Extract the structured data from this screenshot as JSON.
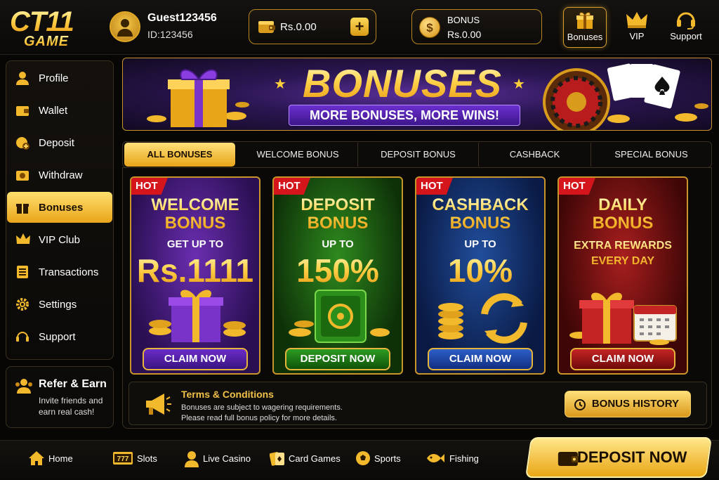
{
  "brand": {
    "logo_line1": "CT11",
    "logo_line2": "GAME"
  },
  "user": {
    "name": "Guest123456",
    "id": "ID:123456"
  },
  "wallet": {
    "amount": "Rs.0.00",
    "add_icon": "plus-icon"
  },
  "bonus_balance": {
    "label": "BONUS",
    "amount": "Rs.0.00",
    "icon": "coin-icon"
  },
  "top_nav": [
    {
      "label": "Bonuses",
      "icon": "gift-icon",
      "active": true
    },
    {
      "label": "VIP",
      "icon": "crown-icon",
      "active": false
    },
    {
      "label": "Support",
      "icon": "headset-icon",
      "active": false
    }
  ],
  "sidebar": {
    "items": [
      {
        "label": "Profile",
        "icon": "user-icon"
      },
      {
        "label": "Wallet",
        "icon": "wallet-icon"
      },
      {
        "label": "Deposit",
        "icon": "deposit-icon"
      },
      {
        "label": "Withdraw",
        "icon": "withdraw-icon"
      },
      {
        "label": "Bonuses",
        "icon": "gift-icon",
        "active": true
      },
      {
        "label": "VIP Club",
        "icon": "crown-icon"
      },
      {
        "label": "Transactions",
        "icon": "list-icon"
      },
      {
        "label": "Settings",
        "icon": "gear-icon"
      },
      {
        "label": "Support",
        "icon": "headset-icon"
      }
    ]
  },
  "refer": {
    "title": "Refer & Earn",
    "subtitle": "Invite friends and earn real cash!",
    "icon": "users-icon"
  },
  "banner": {
    "title": "BONUSES",
    "subtitle": "MORE BONUSES, MORE WINS!"
  },
  "tabs": [
    {
      "label": "ALL BONUSES",
      "active": true
    },
    {
      "label": "WELCOME BONUS"
    },
    {
      "label": "DEPOSIT BONUS"
    },
    {
      "label": "CASHBACK"
    },
    {
      "label": "SPECIAL BONUS"
    }
  ],
  "cards": {
    "welcome": {
      "badge": "HOT",
      "title1": "WELCOME",
      "title2": "BONUS",
      "pre": "GET UP TO",
      "big": "Rs.1111",
      "button": "CLAIM NOW"
    },
    "deposit": {
      "badge": "HOT",
      "title1": "DEPOSIT",
      "title2": "BONUS",
      "pre": "UP TO",
      "big": "150%",
      "button": "DEPOSIT NOW"
    },
    "cashback": {
      "badge": "HOT",
      "title1": "CASHBACK",
      "title2": "BONUS",
      "pre": "UP TO",
      "big": "10%",
      "button": "CLAIM NOW"
    },
    "daily": {
      "badge": "HOT",
      "title1": "DAILY",
      "title2": "BONUS",
      "extra1": "EXTRA REWARDS",
      "extra2": "EVERY DAY",
      "button": "CLAIM NOW"
    }
  },
  "terms": {
    "title": "Terms & Conditions",
    "line1": "Bonuses are subject to wagering requirements.",
    "line2": "Please read full bonus policy for more details.",
    "button": "BONUS HISTORY",
    "icon": "megaphone-icon"
  },
  "bottom_nav": [
    {
      "label": "Home",
      "icon": "home-icon"
    },
    {
      "label": "Slots",
      "icon": "slots-icon"
    },
    {
      "label": "Live Casino",
      "icon": "dealer-icon"
    },
    {
      "label": "Card Games",
      "icon": "cards-icon"
    },
    {
      "label": "Sports",
      "icon": "soccer-ball-icon"
    },
    {
      "label": "Fishing",
      "icon": "fish-icon"
    }
  ],
  "deposit_now": {
    "label": "DEPOSIT NOW",
    "icon": "wallet-icon"
  },
  "colors": {
    "gold": "#f2b92c",
    "background": "#070605",
    "hot_red": "#d4161c"
  }
}
